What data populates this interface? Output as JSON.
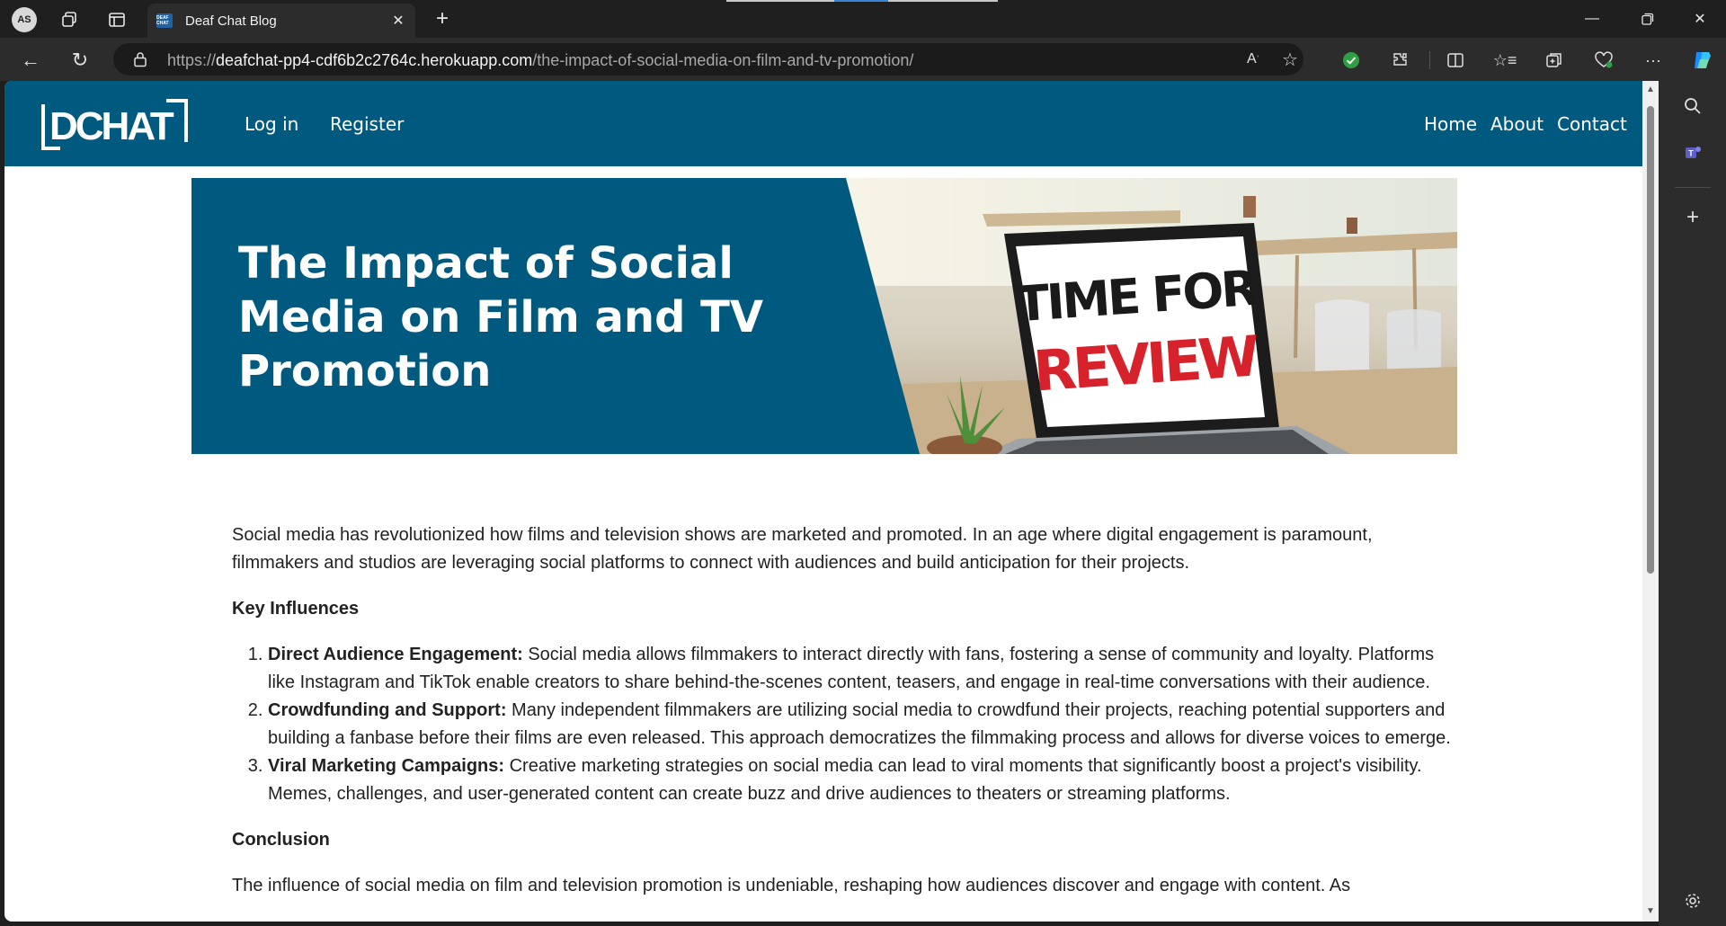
{
  "browser": {
    "profile_initials": "AS",
    "tab_title": "Deaf Chat Blog",
    "tab_favicon_text": "DEAF CHAT",
    "url_proto": "https://",
    "url_host": "deafchat-pp4-cdf6b2c2764c.herokuapp.com",
    "url_path": "/the-impact-of-social-media-on-film-and-tv-promotion/"
  },
  "site": {
    "logo_text": "DCHAT",
    "nav_left": [
      "Log in",
      "Register"
    ],
    "nav_right": [
      "Home",
      "About",
      "Contact"
    ],
    "brand_color": "#005a7f"
  },
  "hero": {
    "title": "The Impact of Social Media on Film and TV Promotion",
    "image_text_line1": "TIME FOR",
    "image_text_line2": "REVIEW"
  },
  "article": {
    "intro": "Social media has revolutionized how films and television shows are marketed and promoted. In an age where digital engagement is paramount, filmmakers and studios are leveraging social platforms to connect with audiences and build anticipation for their projects.",
    "heading_influences": "Key Influences",
    "influences": [
      {
        "title": "Direct Audience Engagement:",
        "text": " Social media allows filmmakers to interact directly with fans, fostering a sense of community and loyalty. Platforms like Instagram and TikTok enable creators to share behind-the-scenes content, teasers, and engage in real-time conversations with their audience."
      },
      {
        "title": "Crowdfunding and Support:",
        "text": " Many independent filmmakers are utilizing social media to crowdfund their projects, reaching potential supporters and building a fanbase before their films are even released. This approach democratizes the filmmaking process and allows for diverse voices to emerge."
      },
      {
        "title": "Viral Marketing Campaigns:",
        "text": " Creative marketing strategies on social media can lead to viral moments that significantly boost a project's visibility. Memes, challenges, and user-generated content can create buzz and drive audiences to theaters or streaming platforms."
      }
    ],
    "heading_conclusion": "Conclusion",
    "conclusion": "The influence of social media on film and television promotion is undeniable, reshaping how audiences discover and engage with content. As"
  }
}
